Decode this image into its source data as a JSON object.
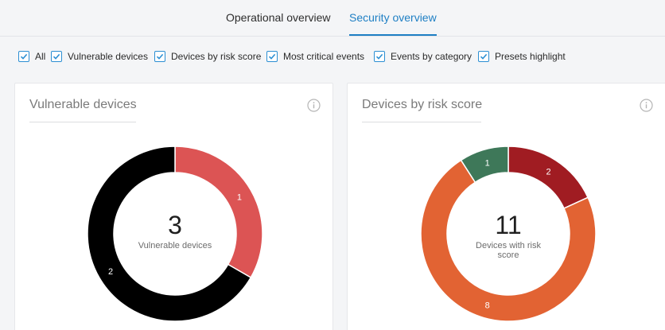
{
  "tabs": [
    {
      "label": "Operational overview",
      "active": false
    },
    {
      "label": "Security overview",
      "active": true
    }
  ],
  "filters": [
    {
      "label": "All",
      "checked": true
    },
    {
      "label": "Vulnerable devices",
      "checked": true
    },
    {
      "label": "Devices by risk score",
      "checked": true
    },
    {
      "label": "Most critical events",
      "checked": true
    },
    {
      "label": "Events by category",
      "checked": true
    },
    {
      "label": "Presets highlight",
      "checked": true
    }
  ],
  "colors": {
    "accent": "#1e7fc4",
    "checkbox": "#2c8fd3"
  },
  "cards": [
    {
      "title": "Vulnerable devices",
      "info_icon": "info-icon",
      "center_value": "3",
      "center_label": "Vulnerable devices"
    },
    {
      "title": "Devices by risk score",
      "info_icon": "info-icon",
      "center_value": "11",
      "center_label": "Devices with risk score"
    }
  ],
  "chart_data": [
    {
      "type": "pie",
      "variant": "donut",
      "title": "Vulnerable devices",
      "total": 3,
      "slices": [
        {
          "value": 1,
          "label": "1",
          "color": "#dc5454"
        },
        {
          "value": 2,
          "label": "2",
          "color": "#000000"
        }
      ]
    },
    {
      "type": "pie",
      "variant": "donut",
      "title": "Devices by risk score",
      "total": 11,
      "slices": [
        {
          "value": 2,
          "label": "2",
          "color": "#a01c22"
        },
        {
          "value": 8,
          "label": "8",
          "color": "#e26333"
        },
        {
          "value": 1,
          "label": "1",
          "color": "#3e7859"
        }
      ]
    }
  ]
}
